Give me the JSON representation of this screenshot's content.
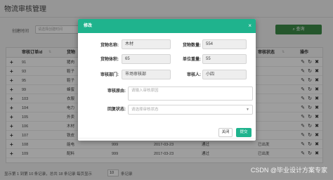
{
  "page": {
    "title": "物流审核管理"
  },
  "filter": {
    "label": "创建时间",
    "placeholder": "请选择创建时间"
  },
  "search_button": "查询",
  "table": {
    "columns": [
      "审核订单id",
      "货物",
      "",
      "",
      "",
      "",
      "审核状态",
      "操作"
    ],
    "rows": [
      {
        "id": "91",
        "name": "猪肉",
        "qty": "",
        "date": "",
        "status": "",
        "audit": ""
      },
      {
        "id": "93",
        "name": "鞋子",
        "qty": "",
        "date": "",
        "status": "",
        "audit": ""
      },
      {
        "id": "95",
        "name": "鞋子",
        "qty": "",
        "date": "",
        "status": "",
        "audit": ""
      },
      {
        "id": "99",
        "name": "蜂蜜",
        "qty": "",
        "date": "",
        "status": "",
        "audit": ""
      },
      {
        "id": "103",
        "name": "衣服",
        "qty": "",
        "date": "",
        "status": "",
        "audit": ""
      },
      {
        "id": "104",
        "name": "电力",
        "qty": "",
        "date": "",
        "status": "",
        "audit": ""
      },
      {
        "id": "105",
        "name": "外卖",
        "qty": "",
        "date": "",
        "status": "",
        "audit": ""
      },
      {
        "id": "106",
        "name": "木材",
        "qty": "",
        "date": "",
        "status": "",
        "audit": ""
      },
      {
        "id": "107",
        "name": "铁皮",
        "qty": "",
        "date": "",
        "status": "",
        "audit": ""
      },
      {
        "id": "108",
        "name": "能电",
        "qty": "999",
        "date": "2017-03-23",
        "status": "通过",
        "audit": "已出发"
      },
      {
        "id": "109",
        "name": "配料",
        "qty": "999",
        "date": "2017-03-23",
        "status": "通过",
        "audit": "已出发"
      }
    ]
  },
  "footer": {
    "summary": "显示第 1 到第 10 条记录，总共 18 条记录 每页显示",
    "page_size": "10",
    "suffix": "条记录"
  },
  "modal": {
    "title": "修改",
    "close_icon": "×",
    "fields": {
      "goods_name_label": "货物名称:",
      "goods_name": "木材",
      "goods_qty_label": "货物数量:",
      "goods_qty": "554",
      "goods_volume_label": "货物体积:",
      "goods_volume": "65",
      "unit_weight_label": "单位重量:",
      "unit_weight": "55",
      "audit_dept_label": "审核部门:",
      "audit_dept": "市场审核部",
      "auditor_label": "审核人:",
      "auditor": "小四",
      "reason_label": "审核原由:",
      "reason_placeholder": "请输入审核原因",
      "reply_label": "回复状态:",
      "reply_placeholder": "请选择审核状态"
    },
    "close_button": "关闭",
    "submit_button": "提交"
  },
  "watermark": "CSDN @毕业设计方案专家"
}
